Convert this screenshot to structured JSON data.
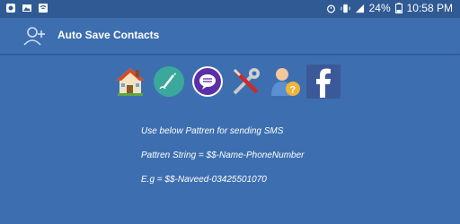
{
  "status_bar": {
    "battery": "24%",
    "time": "10:58 PM",
    "icons": [
      "notification-icon",
      "image-icon",
      "wifi-icon",
      "alarm-icon",
      "vibrate-icon",
      "signal-icon",
      "battery-icon"
    ]
  },
  "app_bar": {
    "title": "Auto Save Contacts",
    "icon": "add-contact-icon"
  },
  "toolbar": {
    "icons": [
      "home-icon",
      "edit-pattern-icon",
      "messages-icon",
      "settings-tools-icon",
      "help-user-icon",
      "facebook-icon"
    ]
  },
  "content": {
    "line1": "Use below Pattren for sending SMS",
    "line2": "Pattren String = $$-Name-PhoneNumber",
    "line3": "E.g = $$-Naveed-03425501070"
  },
  "colors": {
    "background": "#3d6fb0",
    "status_bar": "#2f5a94",
    "edit_circle": "#3aa89a",
    "chat_circle": "#5b2fa6",
    "facebook": "#3b5998"
  }
}
